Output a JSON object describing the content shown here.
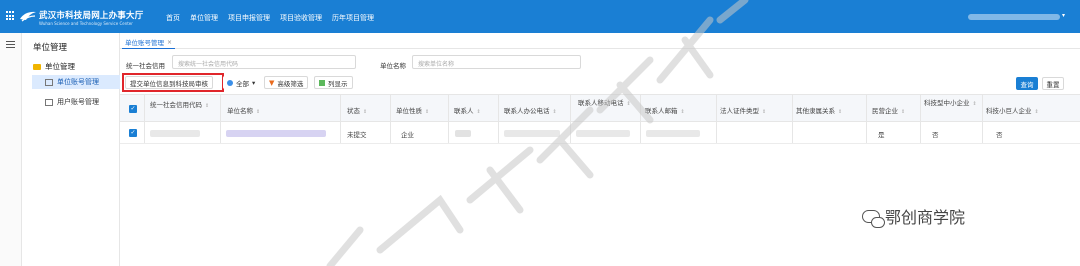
{
  "header": {
    "brand_title": "武汉市科技局网上办事大厅",
    "brand_subtitle": "Wuhan Science and Technology Service Center",
    "nav": [
      "首页",
      "单位管理",
      "项目申报管理",
      "项目验收管理",
      "历年项目管理"
    ]
  },
  "sidebar": {
    "title": "单位管理",
    "group": "单位管理",
    "items": [
      {
        "label": "单位账号管理",
        "active": true
      },
      {
        "label": "用户账号管理",
        "active": false
      }
    ]
  },
  "tabs": [
    {
      "label": "单位账号管理"
    }
  ],
  "filters": {
    "credit_code_label": "统一社会信用",
    "credit_code_placeholder": "搜索统一社会信用代码",
    "unit_name_label": "单位名称",
    "unit_name_placeholder": "搜索单位名称"
  },
  "toolbar": {
    "submit_label": "提交单位信息到科技局审核",
    "all_label": "全部",
    "advanced_label": "高级筛选",
    "columns_label": "列显示",
    "search_label": "查询",
    "reset_label": "重置"
  },
  "table": {
    "columns": [
      "统一社会信用代码",
      "单位名称",
      "状态",
      "单位性质",
      "联系人",
      "联系人办公电话",
      "联系人移动电话",
      "联系人邮箱",
      "法人证件类型",
      "其他隶属关系",
      "民营企业",
      "科技型中小企业",
      "科技小巨人企业"
    ],
    "rows": [
      {
        "status": "未提交",
        "nature": "企业",
        "private": "是",
        "sme": "否",
        "giant": "否"
      }
    ]
  },
  "watermark": {
    "text": "鄂创商学院"
  },
  "colors": {
    "topbar": "#1a7fd4",
    "highlight": "#e0262b"
  }
}
